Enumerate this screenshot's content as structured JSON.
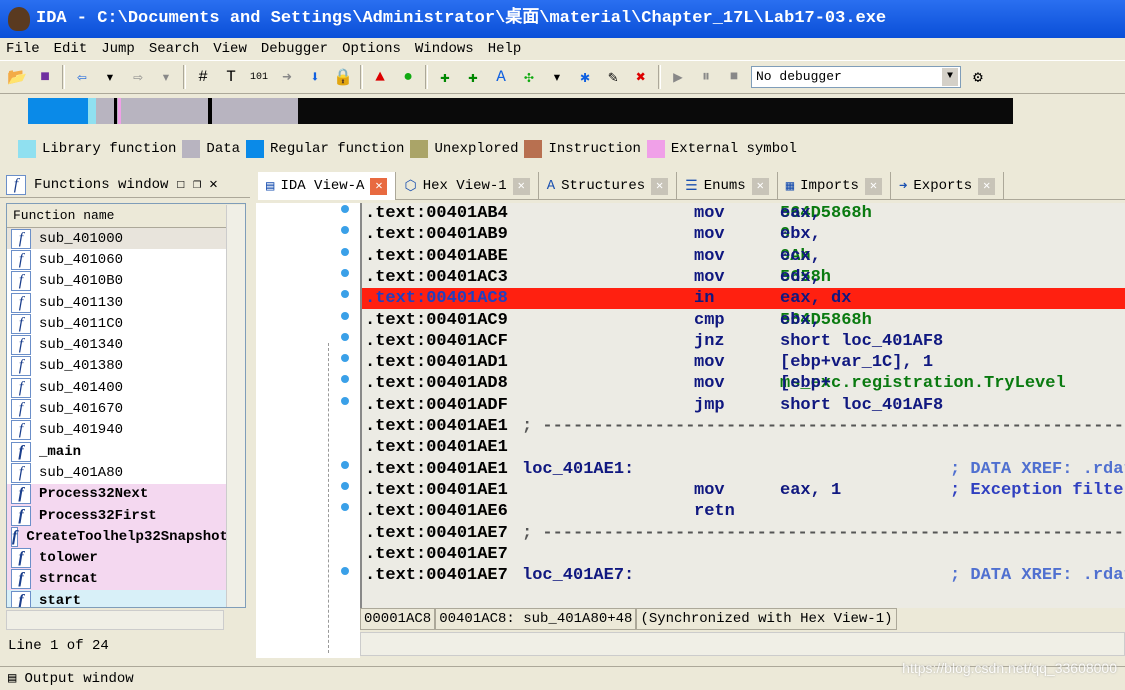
{
  "title": "IDA - C:\\Documents and Settings\\Administrator\\桌面\\material\\Chapter_17L\\Lab17-03.exe",
  "menu": [
    "File",
    "Edit",
    "Jump",
    "Search",
    "View",
    "Debugger",
    "Options",
    "Windows",
    "Help"
  ],
  "toolbar": {
    "debugger_select": "No debugger"
  },
  "legend": [
    {
      "label": "Library function",
      "color": "#90e0f0"
    },
    {
      "label": "Data",
      "color": "#b8b4c0"
    },
    {
      "label": "Regular function",
      "color": "#0a8ae8"
    },
    {
      "label": "Unexplored",
      "color": "#aaa468"
    },
    {
      "label": "Instruction",
      "color": "#b87050"
    },
    {
      "label": "External symbol",
      "color": "#f0a0e8"
    }
  ],
  "functions_window": {
    "title": "Functions window",
    "column": "Function name",
    "status": "Line 1 of 24",
    "items": [
      {
        "name": "sub_401000"
      },
      {
        "name": "sub_401060"
      },
      {
        "name": "sub_4010B0"
      },
      {
        "name": "sub_401130"
      },
      {
        "name": "sub_4011C0"
      },
      {
        "name": "sub_401340"
      },
      {
        "name": "sub_401380"
      },
      {
        "name": "sub_401400"
      },
      {
        "name": "sub_401670"
      },
      {
        "name": "sub_401940"
      },
      {
        "name": "_main",
        "bold": true
      },
      {
        "name": "sub_401A80"
      },
      {
        "name": "Process32Next",
        "kind": "external"
      },
      {
        "name": "Process32First",
        "kind": "external"
      },
      {
        "name": "CreateToolhelp32Snapshot",
        "kind": "external"
      },
      {
        "name": "tolower",
        "kind": "external"
      },
      {
        "name": "strncat",
        "kind": "external"
      },
      {
        "name": "start",
        "kind": "library"
      }
    ]
  },
  "tabs": [
    {
      "label": "IDA View-A",
      "active": true
    },
    {
      "label": "Hex View-1"
    },
    {
      "label": "Structures"
    },
    {
      "label": "Enums"
    },
    {
      "label": "Imports"
    },
    {
      "label": "Exports"
    }
  ],
  "code": [
    {
      "addr": ".text:00401AB4",
      "mn": "mov",
      "op": "eax, ",
      "val": "564D5868h"
    },
    {
      "addr": ".text:00401AB9",
      "mn": "mov",
      "op": "ebx, ",
      "val": "0"
    },
    {
      "addr": ".text:00401ABE",
      "mn": "mov",
      "op": "ecx, ",
      "val": "0Ah"
    },
    {
      "addr": ".text:00401AC3",
      "mn": "mov",
      "op": "edx, ",
      "val": "5658h"
    },
    {
      "addr": ".text:00401AC8",
      "mn": "in",
      "op": "eax, dx",
      "highlight": true
    },
    {
      "addr": ".text:00401AC9",
      "mn": "cmp",
      "op": "ebx, ",
      "val": "564D5868h"
    },
    {
      "addr": ".text:00401ACF",
      "mn": "jnz",
      "op": "short loc_401AF8"
    },
    {
      "addr": ".text:00401AD1",
      "mn": "mov",
      "op": "[ebp+var_1C], 1"
    },
    {
      "addr": ".text:00401AD8",
      "mn": "mov",
      "op": "[ebp+",
      "val": "ms_exc.registration.TryLevel"
    },
    {
      "addr": ".text:00401ADF",
      "mn": "jmp",
      "op": "short loc_401AF8"
    },
    {
      "addr": ".text:00401AE1",
      "sep": "; -----------------------------------------------------------"
    },
    {
      "addr": ".text:00401AE1"
    },
    {
      "addr": ".text:00401AE1",
      "label": "loc_401AE1:",
      "comment": "; DATA XREF: .rdata",
      "xref": true
    },
    {
      "addr": ".text:00401AE1",
      "mn": "mov",
      "op": "eax, 1",
      "comment": "; Exception filter"
    },
    {
      "addr": ".text:00401AE6",
      "mn": "retn"
    },
    {
      "addr": ".text:00401AE7",
      "sep": "; -----------------------------------------------------------"
    },
    {
      "addr": ".text:00401AE7"
    },
    {
      "addr": ".text:00401AE7",
      "label": "loc_401AE7:",
      "comment": "; DATA XREF: .rdata",
      "xref": true
    }
  ],
  "status": [
    "00001AC8",
    "00401AC8: sub_401A80+48",
    "(Synchronized with Hex View-1)"
  ],
  "output_window": "Output window",
  "watermark": "https://blog.csdn.net/qq_33608000"
}
